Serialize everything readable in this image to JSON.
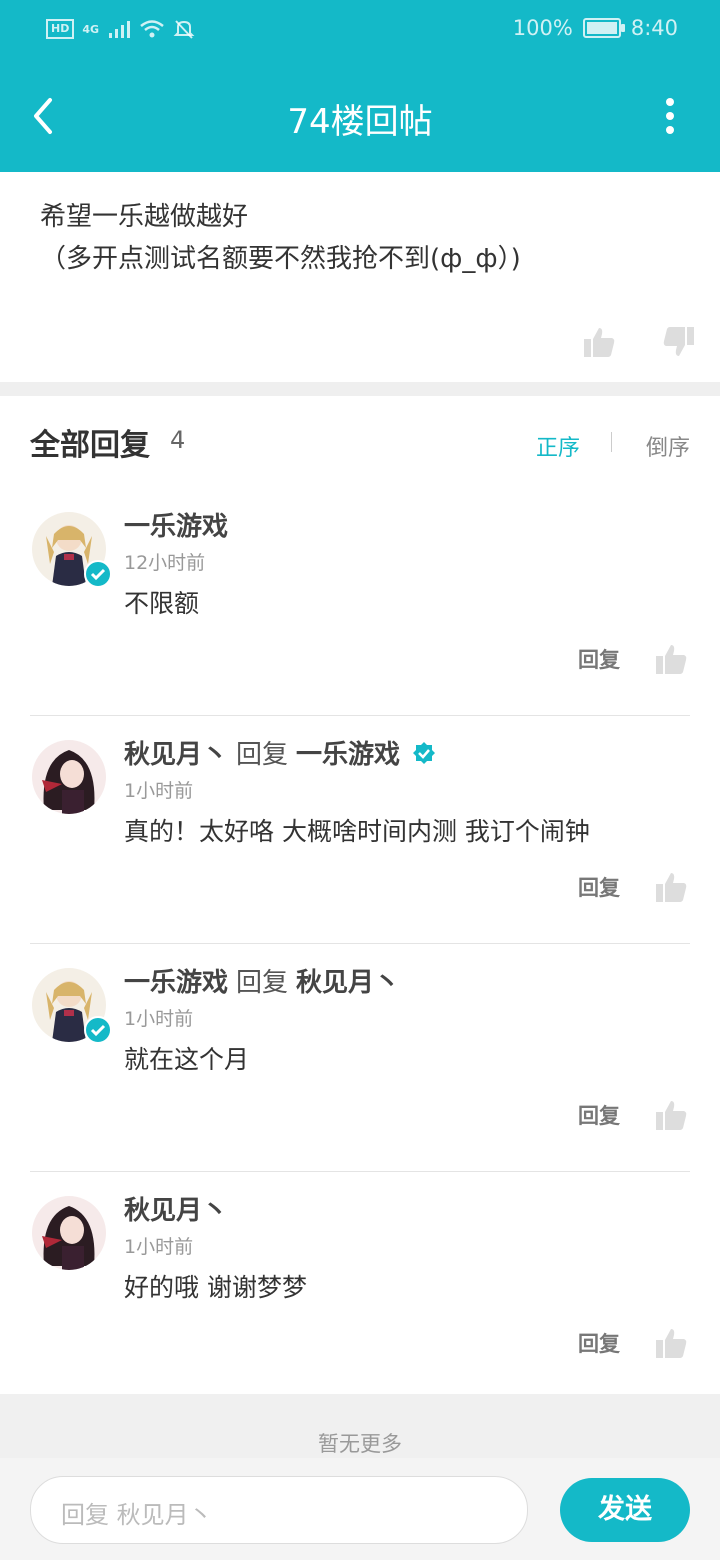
{
  "status_bar": {
    "battery": "100%",
    "time": "8:40",
    "hd": "HD",
    "network": "4G"
  },
  "header": {
    "title": "74楼回帖"
  },
  "post": {
    "lines": [
      "希望一乐越做越好",
      "（多开点测试名额要不然我抢不到(ф_ф）)"
    ]
  },
  "replies_header": {
    "title": "全部回复",
    "count": "4",
    "sort_asc": "正序",
    "sort_desc": "倒序"
  },
  "replies": [
    {
      "name": "一乐游戏",
      "reply_word": "",
      "reply_to": "",
      "time": "12小时前",
      "text": "不限额",
      "action": "回复"
    },
    {
      "name": "秋见月丶",
      "reply_word": "回复",
      "reply_to": "一乐游戏",
      "time": "1小时前",
      "text": "真的！太好咯  大概啥时间内测 我订个闹钟",
      "action": "回复"
    },
    {
      "name": "一乐游戏",
      "reply_word": "回复",
      "reply_to": "秋见月丶",
      "time": "1小时前",
      "text": "就在这个月",
      "action": "回复"
    },
    {
      "name": "秋见月丶",
      "reply_word": "",
      "reply_to": "",
      "time": "1小时前",
      "text": "好的哦  谢谢梦梦",
      "action": "回复"
    }
  ],
  "footer": {
    "no_more": "暂无更多",
    "input_placeholder": "回复 秋见月丶",
    "send_label": "发送"
  },
  "colors": {
    "accent": "#14b9c8"
  }
}
